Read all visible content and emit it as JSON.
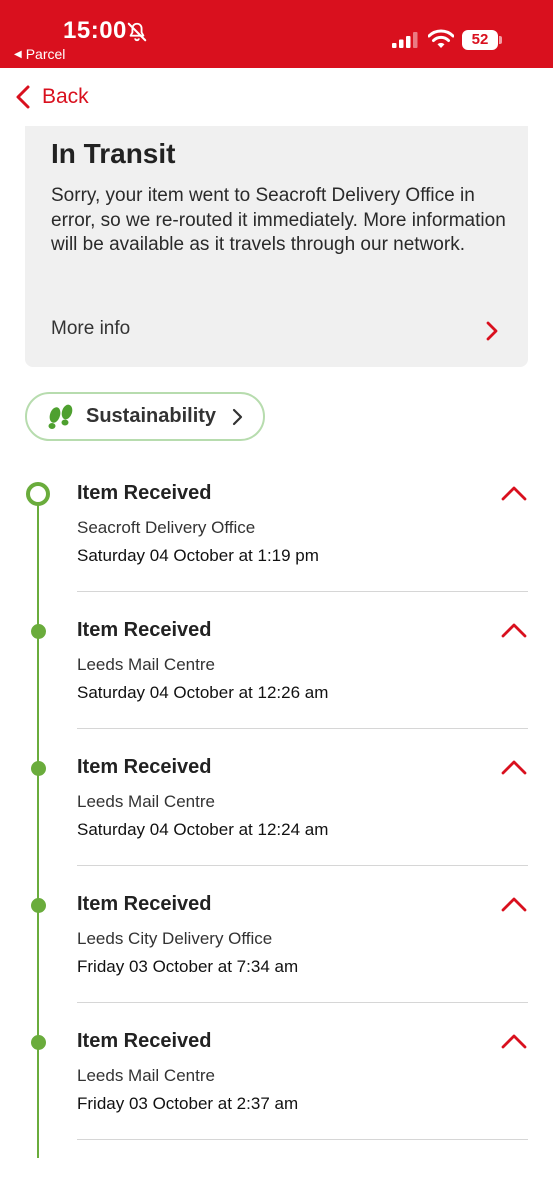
{
  "status_bar": {
    "time": "15:00",
    "back_app_label": "Parcel",
    "battery": "52",
    "icons": [
      "bell-slash-icon",
      "signal-icon",
      "wifi-icon",
      "battery-icon"
    ]
  },
  "nav": {
    "back_label": "Back"
  },
  "status_card": {
    "title": "In Transit",
    "message": "Sorry, your item went to Seacroft Delivery Office in error, so we re-routed it immediately. More information will be available as it travels through our network.",
    "more_info_label": "More info"
  },
  "sustainability": {
    "label": "Sustainability",
    "icon": "footprints-icon"
  },
  "events": [
    {
      "title": "Item Received",
      "location": "Seacroft Delivery Office",
      "datetime": "Saturday 04 October at 1:19 pm"
    },
    {
      "title": "Item Received",
      "location": "Leeds Mail Centre",
      "datetime": "Saturday 04 October at 12:26 am"
    },
    {
      "title": "Item Received",
      "location": "Leeds Mail Centre",
      "datetime": "Saturday 04 October at 12:24 am"
    },
    {
      "title": "Item Received",
      "location": "Leeds City Delivery Office",
      "datetime": "Friday 03 October at 7:34 am"
    },
    {
      "title": "Item Received",
      "location": "Leeds Mail Centre",
      "datetime": "Friday 03 October at 2:37 am"
    }
  ],
  "colors": {
    "brand_red": "#d9101e",
    "timeline_green": "#6aac3c",
    "card_bg": "#f0f0f0"
  }
}
